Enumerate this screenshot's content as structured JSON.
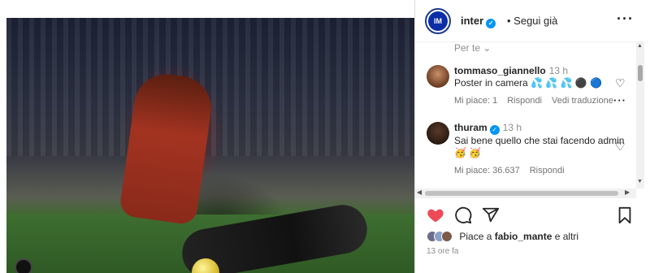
{
  "post": {
    "account": "inter",
    "follow_label": "• Segui già",
    "more_label": "···"
  },
  "comments_section": {
    "filter_label": "Per te ⌄",
    "comments": [
      {
        "user": "tommaso_giannello",
        "time": "13 h",
        "text": "Poster in camera 💦 💦 💦 ⚫ 🔵",
        "likes": "Mi piace: 1",
        "reply": "Rispondi",
        "translate": "Vedi traduzione"
      },
      {
        "user": "thuram",
        "time": "13 h",
        "text": "Sai bene quello che stai facendo admin 🥳 🥳",
        "likes": "Mi piace: 36.637",
        "reply": "Rispondi"
      }
    ]
  },
  "actions": {
    "like_icon": "heart-filled-icon",
    "comment_icon": "comment-icon",
    "share_icon": "share-icon",
    "save_icon": "bookmark-icon"
  },
  "likes": {
    "prefix": "Piace a",
    "user": "fabio_mante",
    "suffix": "e altri"
  },
  "timestamp": "13 ore fa",
  "colors": {
    "like_red": "#ed4956",
    "verified_blue": "#0095f6",
    "inter_blue": "#0b2ea8"
  }
}
